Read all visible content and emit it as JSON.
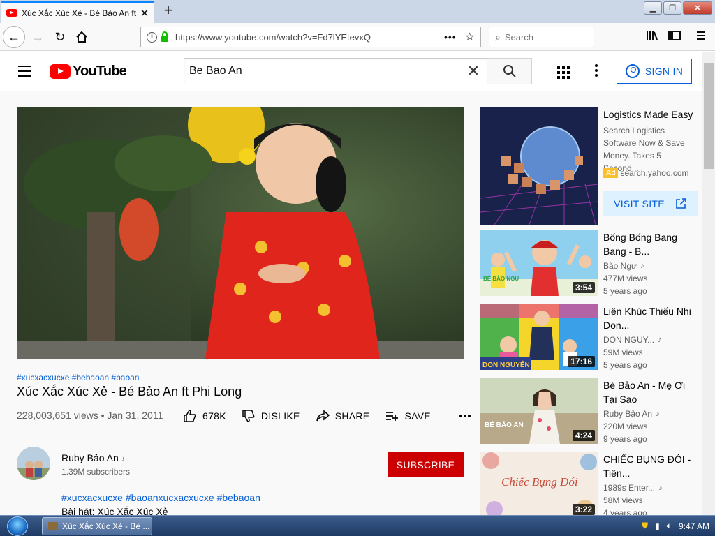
{
  "browser": {
    "tab_title": "Xúc Xắc Xúc Xẻ - Bé Bảo An ft Ph",
    "url": "https://www.youtube.com/watch?v=Fd7lYEtevxQ",
    "search_placeholder": "Search"
  },
  "youtube": {
    "logo_text": "YouTube",
    "search_value": "Be Bao An",
    "signin_label": "SIGN IN"
  },
  "video": {
    "hashtags": "#xucxacxucxe #bebaoan #baoan",
    "title": "Xúc Xắc Xúc Xẻ - Bé Bảo An ft Phi Long",
    "views_date": "228,003,651 views • Jan 31, 2011",
    "likes": "678K",
    "dislike_label": "DISLIKE",
    "share_label": "SHARE",
    "save_label": "SAVE"
  },
  "channel": {
    "name": "Ruby Bảo An",
    "subscribers": "1.39M subscribers",
    "subscribe_label": "SUBSCRIBE"
  },
  "description": {
    "tags": "#xucxacxucxe #baoanxucxacxucxe #bebaoan",
    "line1": "Bài hát: Xúc Xắc Xúc Xẻ"
  },
  "ad": {
    "title": "Logistics Made Easy",
    "desc": "Search Logistics Software Now & Save Money. Takes 5 Second...",
    "badge": "Ad",
    "domain": "search.yahoo.com",
    "cta": "VISIT SITE"
  },
  "recommendations": [
    {
      "title": "Bống Bống Bang Bang - B...",
      "channel": "Bào Ngư",
      "views": "477M views",
      "age": "5 years ago",
      "duration": "3:54"
    },
    {
      "title": "Liên Khúc Thiếu Nhi Don...",
      "channel": "DON NGUY...",
      "views": "59M views",
      "age": "5 years ago",
      "duration": "17:16"
    },
    {
      "title": "Bé Bảo An - Mẹ Ơi Tại Sao",
      "channel": "Ruby Bảo An",
      "views": "220M views",
      "age": "9 years ago",
      "duration": "4:24"
    },
    {
      "title": "CHIẾC BỤNG ĐÓI - Tiên...",
      "channel": "1989s Enter...",
      "views": "58M views",
      "age": "4 years ago",
      "duration": "3:22"
    }
  ],
  "thumb_text": {
    "bong_bong": "BÉ BÀO NGƯ",
    "don_nguyen": "DON NGUYÊN",
    "bao_an": "BÉ BẢO AN",
    "chiec_bung": "Chiếc Bụng Đói"
  },
  "taskbar": {
    "item": "Xúc Xắc Xúc Xẻ - Bé ...",
    "time": "9:47 AM"
  },
  "colors": {
    "youtube_red": "#ff0000",
    "subscribe_red": "#cc0000",
    "link_blue": "#065fd4"
  }
}
